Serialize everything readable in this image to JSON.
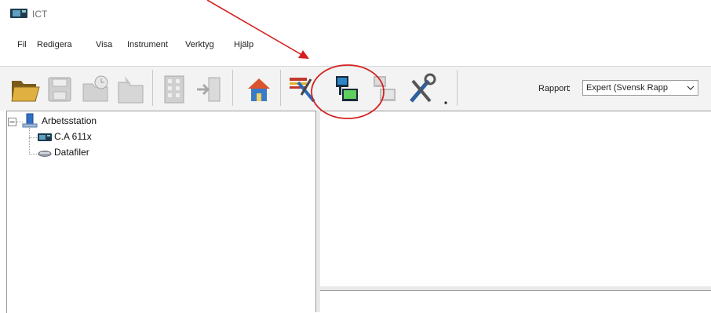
{
  "window": {
    "title": "ICT",
    "icon": "instrument-icon"
  },
  "menu": {
    "items": [
      {
        "label": "Fil"
      },
      {
        "label": "Redigera"
      },
      {
        "label": "Visa"
      },
      {
        "label": "Instrument"
      },
      {
        "label": "Verktyg"
      },
      {
        "label": "Hjälp"
      }
    ]
  },
  "toolbar": {
    "buttons": [
      {
        "icon": "open-folder-icon",
        "enabled": true
      },
      {
        "icon": "save-icon",
        "enabled": false
      },
      {
        "icon": "recent-folder-icon",
        "enabled": false
      },
      {
        "icon": "folder-icon",
        "enabled": false
      },
      {
        "icon": "building-icon",
        "enabled": false
      },
      {
        "icon": "import-icon",
        "enabled": false
      },
      {
        "icon": "home-icon",
        "enabled": true
      },
      {
        "icon": "configure-instrument-icon",
        "enabled": true
      },
      {
        "icon": "connect-instrument-icon",
        "enabled": true
      },
      {
        "icon": "disconnect-instrument-icon",
        "enabled": false
      },
      {
        "icon": "tools-icon",
        "enabled": true
      }
    ],
    "report_label": "Rapport",
    "report_value": "Expert (Svensk Rapp"
  },
  "tree": {
    "root": {
      "label": "Arbetsstation",
      "icon": "workstation-icon",
      "expanded": true
    },
    "children": [
      {
        "label": "C.A 611x",
        "icon": "instrument-icon"
      },
      {
        "label": "Datafiler",
        "icon": "datafiles-icon"
      }
    ]
  },
  "annotation": {
    "arrow_color": "#d42020",
    "highlight_color": "#d42020"
  }
}
